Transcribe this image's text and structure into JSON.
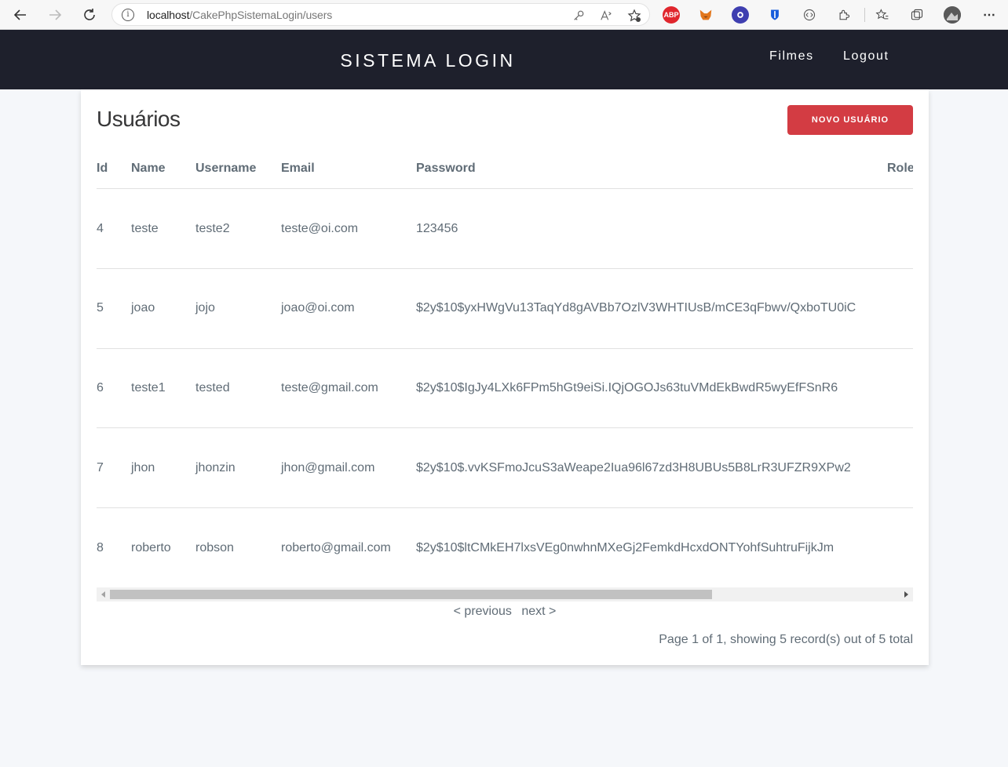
{
  "browser": {
    "url_host": "localhost",
    "url_path": "/CakePhpSistemaLogin/users"
  },
  "header": {
    "brand": "SISTEMA LOGIN",
    "links": [
      "Filmes",
      "Logout"
    ]
  },
  "page": {
    "title": "Usuários",
    "new_button": "NOVO USUÁRIO"
  },
  "table": {
    "columns": [
      "Id",
      "Name",
      "Username",
      "Email",
      "Password",
      "Role"
    ],
    "rows": [
      {
        "id": "4",
        "name": "teste",
        "username": "teste2",
        "email": "teste@oi.com",
        "password": "123456"
      },
      {
        "id": "5",
        "name": "joao",
        "username": "jojo",
        "email": "joao@oi.com",
        "password": "$2y$10$yxHWgVu13TaqYd8gAVBb7OzlV3WHTIUsB/mCE3qFbwv/QxboTU0iC"
      },
      {
        "id": "6",
        "name": "teste1",
        "username": "tested",
        "email": "teste@gmail.com",
        "password": "$2y$10$IgJy4LXk6FPm5hGt9eiSi.IQjOGOJs63tuVMdEkBwdR5wyEfFSnR6"
      },
      {
        "id": "7",
        "name": "jhon",
        "username": "jhonzin",
        "email": "jhon@gmail.com",
        "password": "$2y$10$.vvKSFmoJcuS3aWeape2Iua96l67zd3H8UBUs5B8LrR3UFZR9XPw2"
      },
      {
        "id": "8",
        "name": "roberto",
        "username": "robson",
        "email": "roberto@gmail.com",
        "password": "$2y$10$ltCMkEH7lxsVEg0nwhnMXeGj2FemkdHcxdONTYohfSuhtruFijkJm"
      }
    ]
  },
  "pagination": {
    "previous": "< previous",
    "next": "next >",
    "counter": "Page 1 of 1, showing 5 record(s) out of 5 total"
  }
}
